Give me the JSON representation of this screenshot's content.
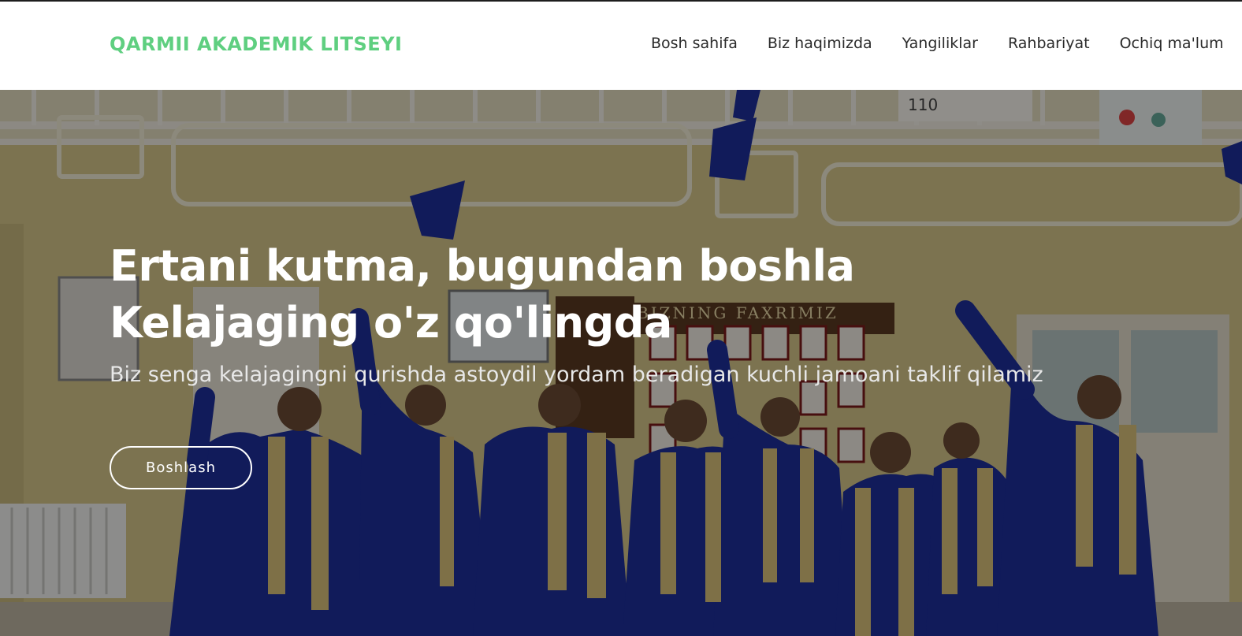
{
  "header": {
    "brand": "QARMII AKADEMIK LITSEYI",
    "nav": [
      {
        "label": "Bosh sahifa"
      },
      {
        "label": "Biz haqimizda"
      },
      {
        "label": "Yangiliklar"
      },
      {
        "label": "Rahbariyat"
      },
      {
        "label": "Ochiq ma'lum"
      }
    ]
  },
  "hero": {
    "title_line1": "Ertani kutma, bugundan boshla",
    "title_line2": "Kelajaging o'z qo'lingda",
    "subtitle": "Biz senga kelajagingni qurishda astoydil yordam beradigan kuchli jamoani taklif qilamiz",
    "button_label": "Boshlash",
    "wall_sign": "BIZNING FAXRIMIZ",
    "room_number": "110"
  },
  "colors": {
    "brand": "#5fcf80",
    "nav_text": "#2b2b2b",
    "robe": "#1e2f9c",
    "stole": "#d9c27a",
    "wall": "#d8c98c"
  }
}
